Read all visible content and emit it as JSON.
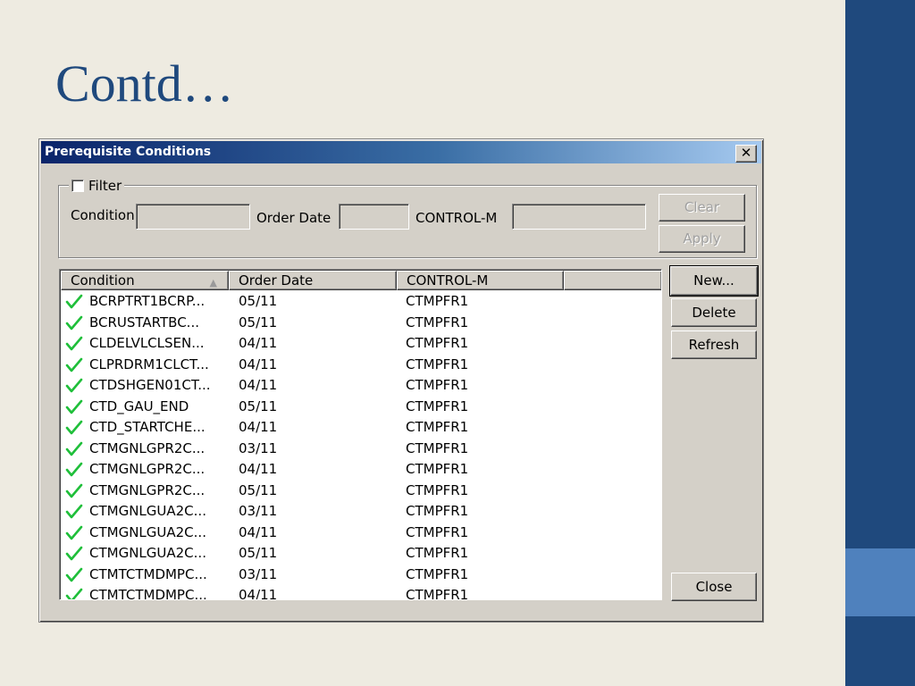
{
  "slide": {
    "title": "Contd…"
  },
  "dialog": {
    "title": "Prerequisite Conditions",
    "close_glyph": "✕",
    "filter": {
      "label": "Filter",
      "checked": false,
      "condition_label": "Condition",
      "condition_value": "",
      "order_date_label": "Order Date",
      "order_date_value": "",
      "controlm_label": "CONTROL-M",
      "controlm_value": "",
      "clear_label": "Clear",
      "apply_label": "Apply"
    },
    "list": {
      "columns": [
        "Condition",
        "Order Date",
        "CONTROL-M",
        ""
      ],
      "sort_glyph": "▲",
      "rows": [
        {
          "condition": "BCRPTRT1BCRP...",
          "order_date": "05/11",
          "controlm": "CTMPFR1"
        },
        {
          "condition": "BCRUSTARTBC...",
          "order_date": "05/11",
          "controlm": "CTMPFR1"
        },
        {
          "condition": "CLDELVLCLSEN...",
          "order_date": "04/11",
          "controlm": "CTMPFR1"
        },
        {
          "condition": "CLPRDRM1CLCT...",
          "order_date": "04/11",
          "controlm": "CTMPFR1"
        },
        {
          "condition": "CTDSHGEN01CT...",
          "order_date": "04/11",
          "controlm": "CTMPFR1"
        },
        {
          "condition": "CTD_GAU_END",
          "order_date": "05/11",
          "controlm": "CTMPFR1"
        },
        {
          "condition": "CTD_STARTCHE...",
          "order_date": "04/11",
          "controlm": "CTMPFR1"
        },
        {
          "condition": "CTMGNLGPR2C...",
          "order_date": "03/11",
          "controlm": "CTMPFR1"
        },
        {
          "condition": "CTMGNLGPR2C...",
          "order_date": "04/11",
          "controlm": "CTMPFR1"
        },
        {
          "condition": "CTMGNLGPR2C...",
          "order_date": "05/11",
          "controlm": "CTMPFR1"
        },
        {
          "condition": "CTMGNLGUA2C...",
          "order_date": "03/11",
          "controlm": "CTMPFR1"
        },
        {
          "condition": "CTMGNLGUA2C...",
          "order_date": "04/11",
          "controlm": "CTMPFR1"
        },
        {
          "condition": "CTMGNLGUA2C...",
          "order_date": "05/11",
          "controlm": "CTMPFR1"
        },
        {
          "condition": "CTMTCTMDMPC...",
          "order_date": "03/11",
          "controlm": "CTMPFR1"
        },
        {
          "condition": "CTMTCTMDMPC...",
          "order_date": "04/11",
          "controlm": "CTMPFR1"
        }
      ]
    },
    "buttons": {
      "new": "New...",
      "delete": "Delete",
      "refresh": "Refresh",
      "close": "Close"
    },
    "colors": {
      "check": "#1fbf3a",
      "titlebar_start": "#0a246a",
      "titlebar_end": "#a6caf0"
    }
  }
}
